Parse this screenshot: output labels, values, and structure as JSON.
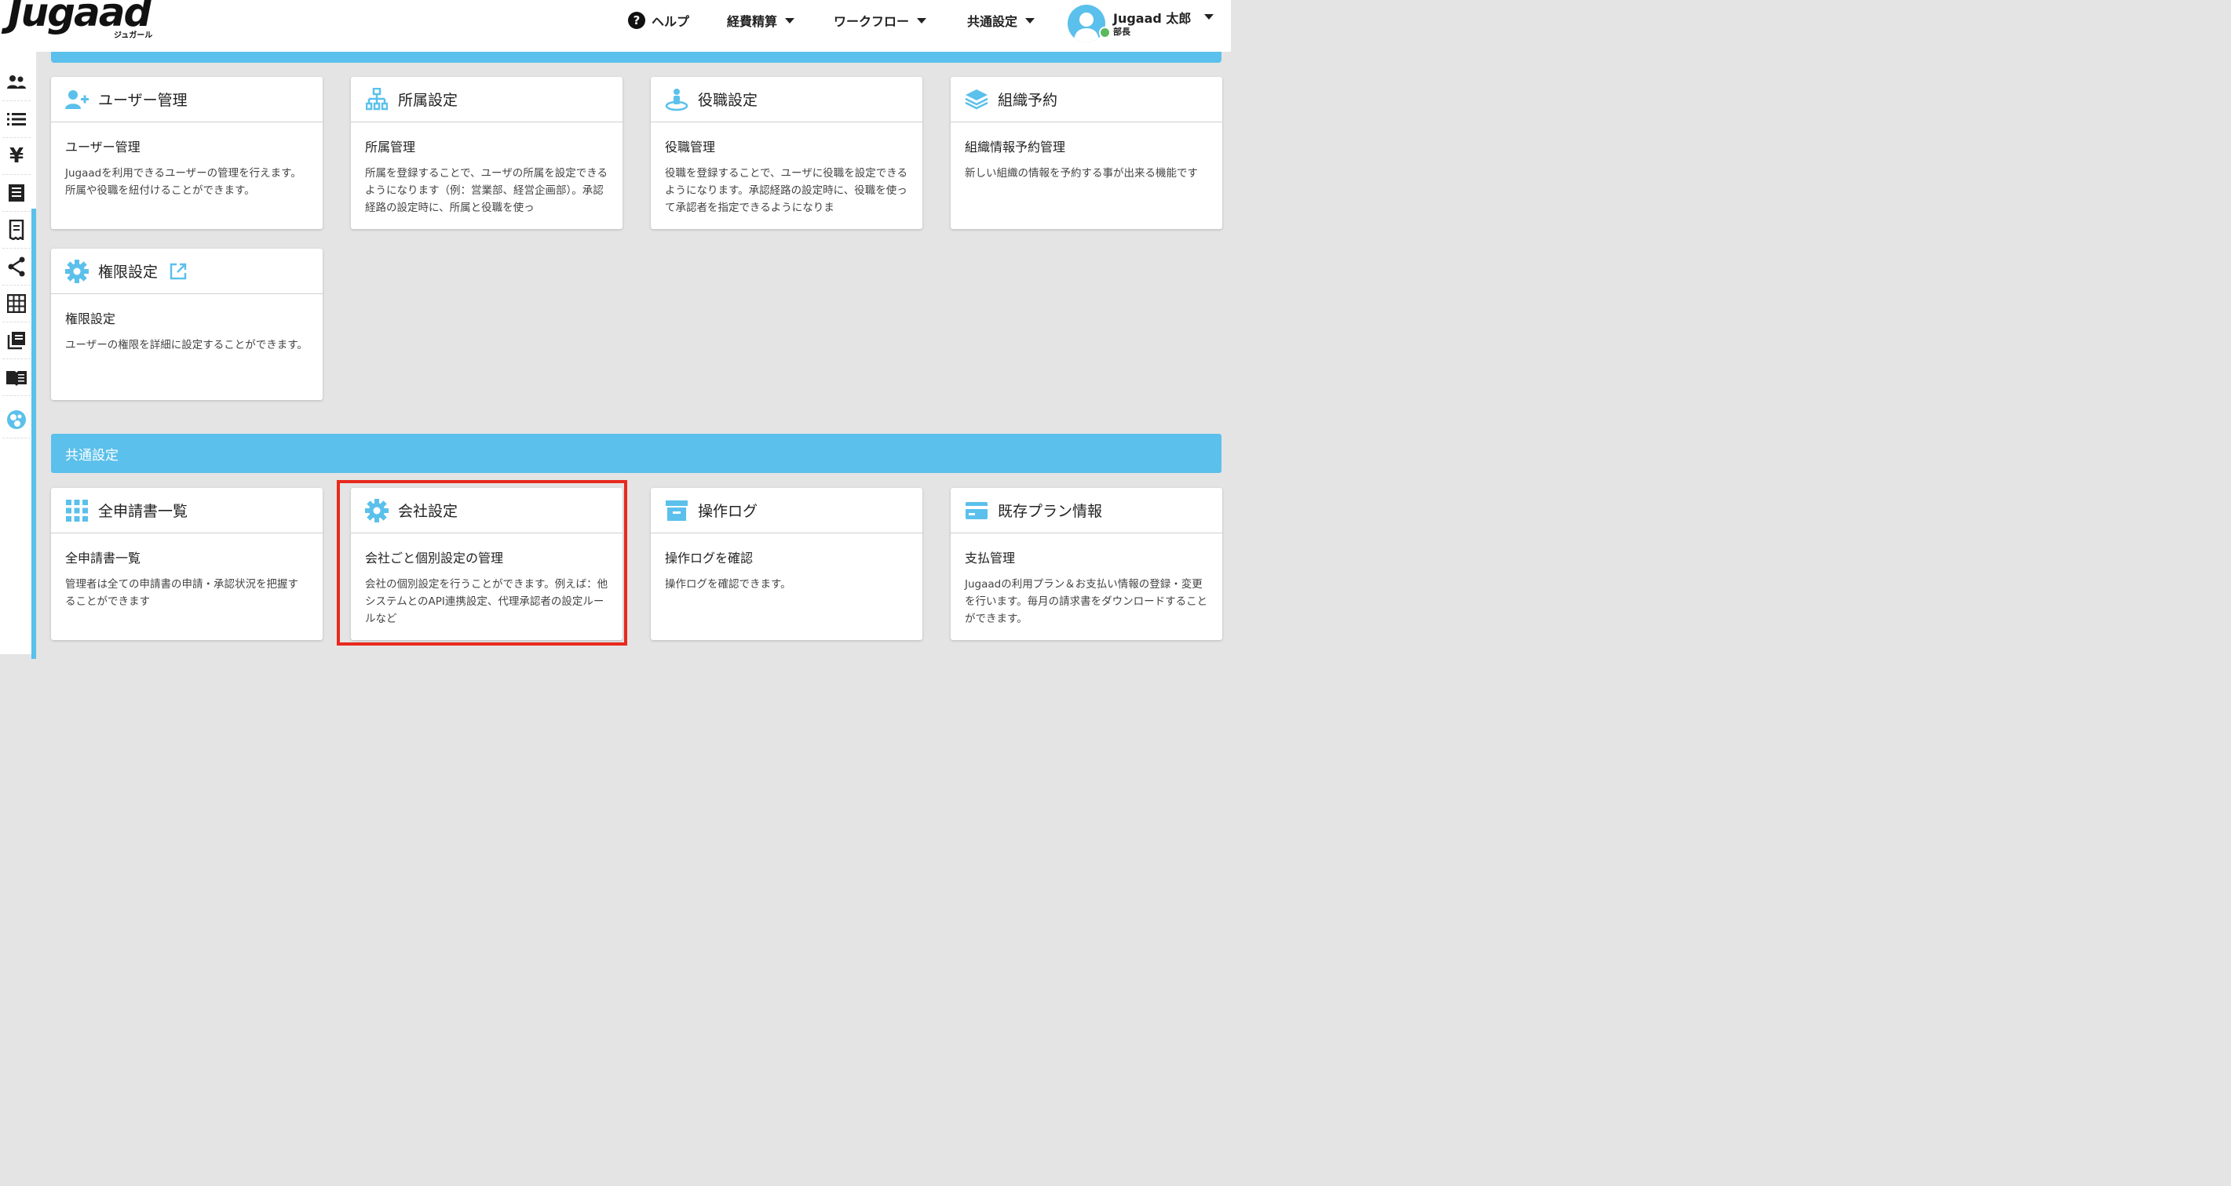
{
  "header": {
    "logo": "Jugaad",
    "logo_sub": "ジュガール",
    "help_label": "ヘルプ",
    "nav": [
      {
        "label": "経費精算"
      },
      {
        "label": "ワークフロー"
      },
      {
        "label": "共通設定"
      }
    ],
    "user": {
      "name": "Jugaad 太郎",
      "role": "部長"
    }
  },
  "sidebar": {
    "icons": [
      "users-icon",
      "list-icon",
      "yen-icon",
      "document-list-icon",
      "receipt-icon",
      "share-icon",
      "grid-icon",
      "library-icon",
      "book-icon",
      "globe-icon"
    ]
  },
  "cards": [
    {
      "title": "ユーザー管理",
      "sub": "ユーザー管理",
      "desc": "Jugaadを利用できるユーザーの管理を行えます。所属や役職を紐付けることができます。"
    },
    {
      "title": "所属設定",
      "sub": "所属管理",
      "desc": "所属を登録することで、ユーザの所属を設定できるようになります（例：営業部、経営企画部）。承認経路の設定時に、所属と役職を使っ"
    },
    {
      "title": "役職設定",
      "sub": "役職管理",
      "desc": "役職を登録することで、ユーザに役職を設定できるようになります。承認経路の設定時に、役職を使って承認者を指定できるようになりま"
    },
    {
      "title": "組織予約",
      "sub": "組織情報予約管理",
      "desc": "新しい組織の情報を予約する事が出来る機能です"
    },
    {
      "title": "権限設定",
      "sub": "権限設定",
      "desc": "ユーザーの権限を詳細に設定することができます。"
    }
  ],
  "section": {
    "label": "共通設定"
  },
  "common_cards": [
    {
      "title": "全申請書一覧",
      "sub": "全申請書一覧",
      "desc": "管理者は全ての申請書の申請・承認状況を把握することができます"
    },
    {
      "title": "会社設定",
      "sub": "会社ごと個別設定の管理",
      "desc": "会社の個別設定を行うことができます。例えば：他システムとのAPI連携設定、代理承認者の設定ルールなど"
    },
    {
      "title": "操作ログ",
      "sub": "操作ログを確認",
      "desc": "操作ログを確認できます。"
    },
    {
      "title": "既存プラン情報",
      "sub": "支払管理",
      "desc": "Jugaadの利用プラン＆お支払い情報の登録・変更を行います。毎月の請求書をダウンロードすることができます。"
    }
  ],
  "colors": {
    "accent": "#5bc0eb",
    "highlight": "#e8291d",
    "background": "#e4e4e4"
  }
}
